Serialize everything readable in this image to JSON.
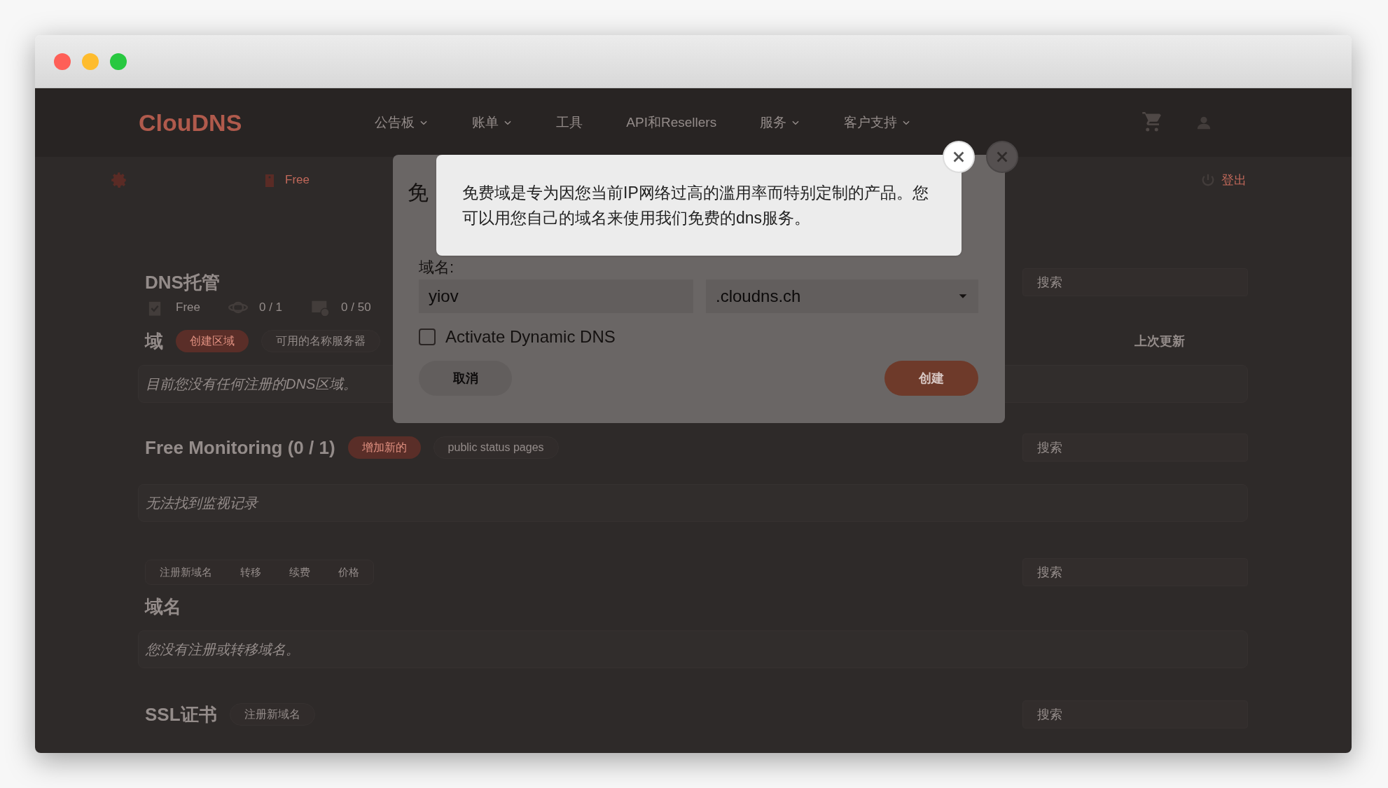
{
  "window": {
    "controls": [
      {
        "color": "#fe5f57"
      },
      {
        "color": "#febc2e"
      },
      {
        "color": "#28c840"
      }
    ]
  },
  "header": {
    "logo": "ClouDNS",
    "nav": [
      {
        "label": "公告板",
        "dropdown": true
      },
      {
        "label": "账单",
        "dropdown": true
      },
      {
        "label": "工具",
        "dropdown": false
      },
      {
        "label": "API和Resellers",
        "dropdown": false
      },
      {
        "label": "服务",
        "dropdown": true
      },
      {
        "label": "客户支持",
        "dropdown": true
      }
    ]
  },
  "subbar": {
    "plan": "Free",
    "logout": "登出"
  },
  "dns_hosting": {
    "title": "DNS托管",
    "search": {
      "placeholder": "搜索"
    },
    "stats": [
      {
        "kind": "plan",
        "text": "Free"
      },
      {
        "kind": "zones",
        "text": "0 / 1"
      },
      {
        "kind": "records",
        "text": "0 / 50"
      }
    ],
    "zones_label": "域",
    "buttons": [
      {
        "label": "创建区域",
        "kind": "primary"
      },
      {
        "label": "可用的名称服务器",
        "kind": "secondary"
      }
    ],
    "column": "上次更新",
    "empty": "目前您没有任何注册的DNS区域。"
  },
  "monitoring": {
    "title": "Free Monitoring (0 / 1)",
    "buttons": [
      {
        "label": "增加新的",
        "kind": "primary"
      },
      {
        "label": "public status pages",
        "kind": "secondary"
      }
    ],
    "search": {
      "placeholder": "搜索"
    },
    "empty": "无法找到监视记录"
  },
  "domains": {
    "tabs": [
      {
        "label": "注册新域名"
      },
      {
        "label": "转移"
      },
      {
        "label": "续费"
      },
      {
        "label": "价格"
      }
    ],
    "search": {
      "placeholder": "搜索"
    },
    "title": "域名",
    "empty": "您没有注册或转移域名。"
  },
  "ssl": {
    "title": "SSL证书",
    "buttons": [
      {
        "label": "注册新域名",
        "kind": "secondary"
      }
    ],
    "search": {
      "placeholder": "搜索"
    }
  },
  "modal": {
    "title": "免",
    "label": "域名:",
    "name_value": "yiov",
    "zone_value": ".cloudns.ch",
    "checkbox": {
      "label": "Activate Dynamic DNS",
      "checked": false
    },
    "cancel": "取消",
    "create": "创建"
  },
  "tooltip": {
    "text": "免费域是专为因您当前IP网络过高的滥用率而特别定制的产品。您可以用您自己的域名来使用我们免费的dns服务。"
  }
}
